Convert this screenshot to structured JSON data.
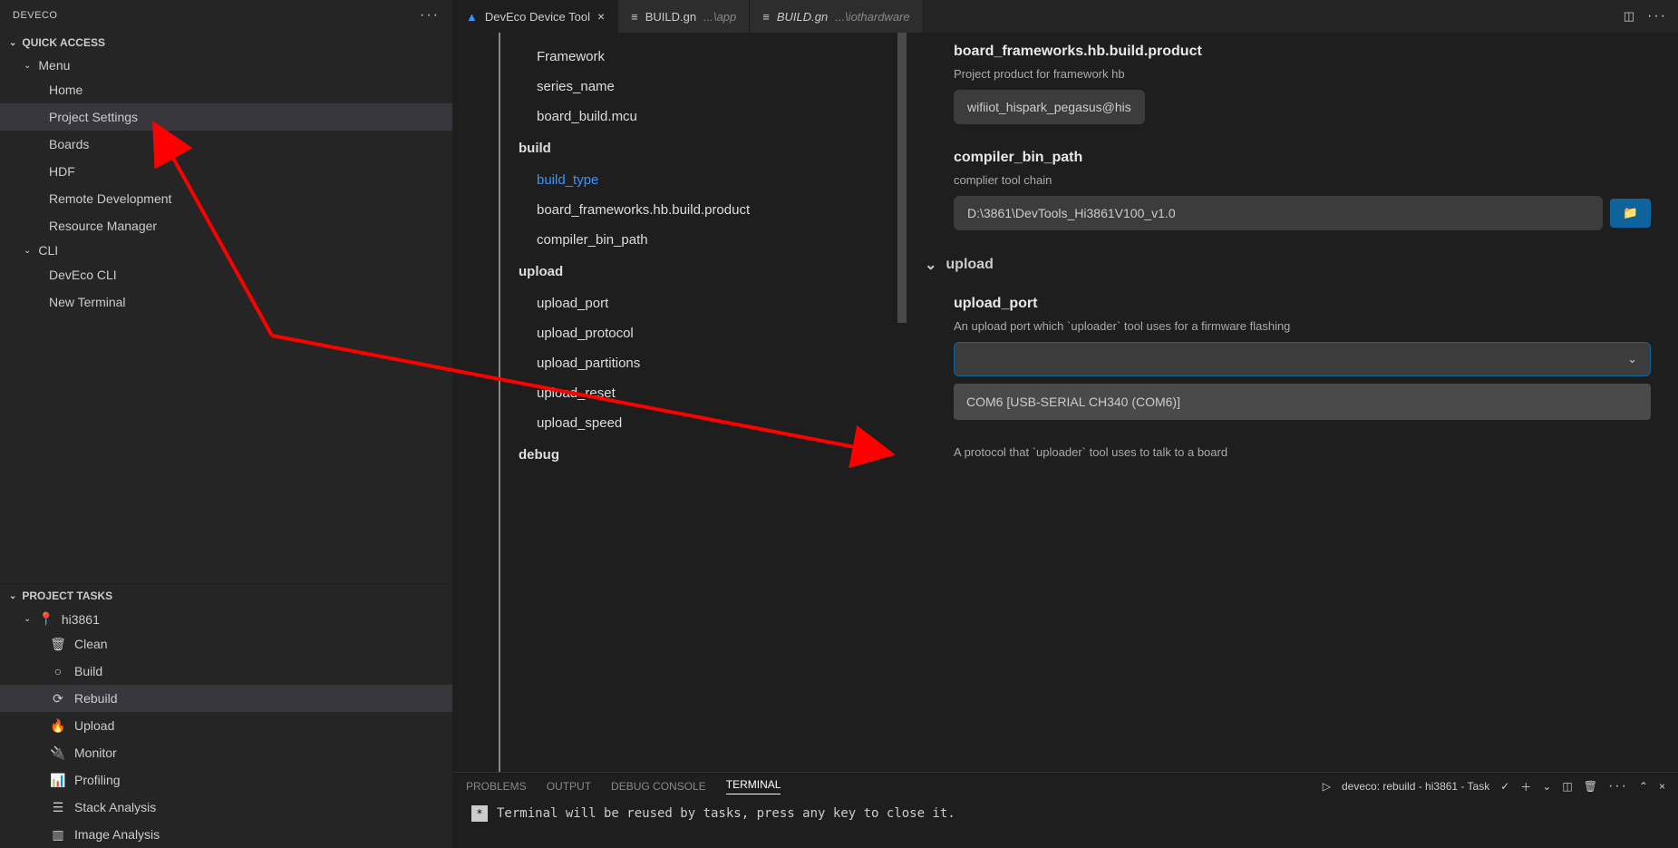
{
  "sidebar": {
    "title": "DEVECO",
    "quickAccess": {
      "label": "QUICK ACCESS",
      "menu": {
        "label": "Menu",
        "items": [
          {
            "label": "Home"
          },
          {
            "label": "Project Settings"
          },
          {
            "label": "Boards"
          },
          {
            "label": "HDF"
          },
          {
            "label": "Remote Development"
          },
          {
            "label": "Resource Manager"
          }
        ]
      },
      "cli": {
        "label": "CLI",
        "items": [
          {
            "label": "DevEco CLI"
          },
          {
            "label": "New Terminal"
          }
        ]
      }
    },
    "projectTasks": {
      "label": "PROJECT TASKS",
      "board": "hi3861",
      "tasks": [
        {
          "label": "Clean",
          "icon": "trash"
        },
        {
          "label": "Build",
          "icon": "circle"
        },
        {
          "label": "Rebuild",
          "icon": "refresh"
        },
        {
          "label": "Upload",
          "icon": "flame"
        },
        {
          "label": "Monitor",
          "icon": "plug"
        },
        {
          "label": "Profiling",
          "icon": "chart"
        },
        {
          "label": "Stack Analysis",
          "icon": "layers"
        },
        {
          "label": "Image Analysis",
          "icon": "bars"
        }
      ]
    }
  },
  "tabs": [
    {
      "label": "DevEco Device Tool",
      "active": true,
      "logo": true
    },
    {
      "label": "BUILD.gn",
      "suffix": "...\\app"
    },
    {
      "label": "BUILD.gn",
      "suffix": "...\\iothardware",
      "italic": true
    }
  ],
  "navTree": {
    "top": [
      {
        "label": "Framework"
      },
      {
        "label": "series_name"
      },
      {
        "label": "board_build.mcu"
      }
    ],
    "build": {
      "label": "build",
      "items": [
        {
          "label": "build_type",
          "active": true
        },
        {
          "label": "board_frameworks.hb.build.product"
        },
        {
          "label": "compiler_bin_path"
        }
      ]
    },
    "upload": {
      "label": "upload",
      "items": [
        {
          "label": "upload_port"
        },
        {
          "label": "upload_protocol"
        },
        {
          "label": "upload_partitions"
        },
        {
          "label": "upload_reset"
        },
        {
          "label": "upload_speed"
        }
      ]
    },
    "debug": {
      "label": "debug"
    }
  },
  "settings": {
    "frameworks": {
      "title": "board_frameworks.hb.build.product",
      "desc": "Project product for framework hb",
      "value": "wifiiot_hispark_pegasus@hisilicon"
    },
    "compiler": {
      "title": "compiler_bin_path",
      "desc": "complier tool chain",
      "value": "D:\\3861\\DevTools_Hi3861V100_v1.0"
    },
    "uploadSection": "upload",
    "uploadPort": {
      "title": "upload_port",
      "desc": "An upload port which `uploader` tool uses for a firmware flashing",
      "option": "COM6 [USB-SERIAL CH340 (COM6)]"
    },
    "uploadProtocol": {
      "desc": "A protocol that `uploader` tool uses to talk to a board"
    }
  },
  "terminal": {
    "tabs": [
      "PROBLEMS",
      "OUTPUT",
      "DEBUG CONSOLE",
      "TERMINAL"
    ],
    "status": "deveco: rebuild - hi3861 - Task",
    "body": "Terminal will be reused by tasks, press any key to close it."
  }
}
